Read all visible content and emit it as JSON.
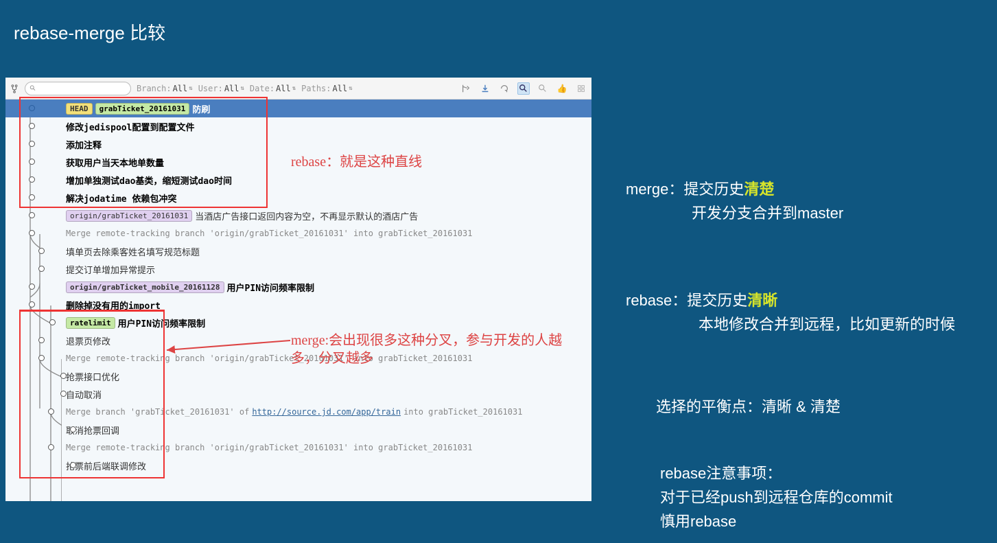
{
  "title": "rebase-merge 比较",
  "right": {
    "merge_label": "merge：提交历史",
    "merge_hl": "清楚",
    "merge_line2": "开发分支合并到master",
    "rebase_label": "rebase：提交历史",
    "rebase_hl": "清晰",
    "rebase_line2": "本地修改合并到远程，比如更新的时候",
    "balance": "选择的平衡点：清晰 & 清楚",
    "note_title": "rebase注意事项：",
    "note_line1": "对于已经push到远程仓库的commit",
    "note_line2": "慎用rebase"
  },
  "toolbar": {
    "search_placeholder": "",
    "filters": [
      {
        "label": "Branch:",
        "value": "All"
      },
      {
        "label": "User:",
        "value": "All"
      },
      {
        "label": "Date:",
        "value": "All"
      },
      {
        "label": "Paths:",
        "value": "All"
      }
    ]
  },
  "annotations": {
    "rebase": "rebase：就是这种直线",
    "merge": "merge:会出现很多这种分叉，参与开发的人越多，分叉越多"
  },
  "commits": [
    {
      "type": "blue",
      "tags": [
        {
          "cls": "head",
          "text": "HEAD"
        },
        {
          "cls": "branch",
          "text": "grabTicket_20161031"
        }
      ],
      "msg": "防刷",
      "dotx": 32,
      "dotcls": "blue"
    },
    {
      "type": "bold",
      "msg": "修改jedispool配置到配置文件",
      "dotx": 32
    },
    {
      "type": "bold",
      "msg": "添加注释",
      "dotx": 32
    },
    {
      "type": "bold",
      "msg": "获取用户当天本地单数量",
      "dotx": 32
    },
    {
      "type": "bold",
      "msg": "增加单独测试dao基类，缩短测试dao时间",
      "dotx": 32
    },
    {
      "type": "bold",
      "msg": "解决jodatime 依赖包冲突",
      "dotx": 32
    },
    {
      "type": "norm",
      "tags": [
        {
          "cls": "remote",
          "text": "origin/grabTicket_20161031"
        }
      ],
      "msg": "当酒店广告接口返回内容为空，不再显示默认的酒店广告",
      "dotx": 32
    },
    {
      "type": "gray",
      "msg": "Merge remote-tracking branch 'origin/grabTicket_20161031' into grabTicket_20161031",
      "dotx": 32
    },
    {
      "type": "norm",
      "msg": "填单页去除乘客姓名填写规范标题",
      "dotx": 46
    },
    {
      "type": "norm",
      "msg": "提交订单增加异常提示",
      "dotx": 46
    },
    {
      "type": "bold",
      "tags": [
        {
          "cls": "remote",
          "text": "origin/grabTicket_mobile_20161128"
        }
      ],
      "msg": "用户PIN访问频率限制",
      "dotx": 32
    },
    {
      "type": "bold",
      "msg": "删除掉没有用的import",
      "dotx": 32
    },
    {
      "type": "bold",
      "tags": [
        {
          "cls": "rate",
          "text": "ratelimit"
        }
      ],
      "msg": "用户PIN访问频率限制",
      "dotx": 62
    },
    {
      "type": "norm",
      "msg": "退票页修改",
      "dotx": 46
    },
    {
      "type": "gray",
      "msg": "Merge remote-tracking branch 'origin/grabTicket_20161031' into grabTicket_20161031",
      "dotx": 46
    },
    {
      "type": "norm",
      "msg": "抢票接口优化",
      "dotx": 78
    },
    {
      "type": "norm",
      "msg": "自动取消",
      "dotx": 78
    },
    {
      "type": "gray",
      "msg": "Merge branch 'grabTicket_20161031' of ",
      "link": "http://source.jd.com/app/train",
      "msg2": " into grabTicket_20161031",
      "dotx": 60
    },
    {
      "type": "norm",
      "msg": "取消抢票回调",
      "dotx": 92
    },
    {
      "type": "gray",
      "msg": "Merge remote-tracking branch 'origin/grabTicket_20161031' into grabTicket_20161031",
      "dotx": 60
    },
    {
      "type": "norm",
      "msg": "抢票前后端联调修改",
      "dotx": 92
    }
  ]
}
